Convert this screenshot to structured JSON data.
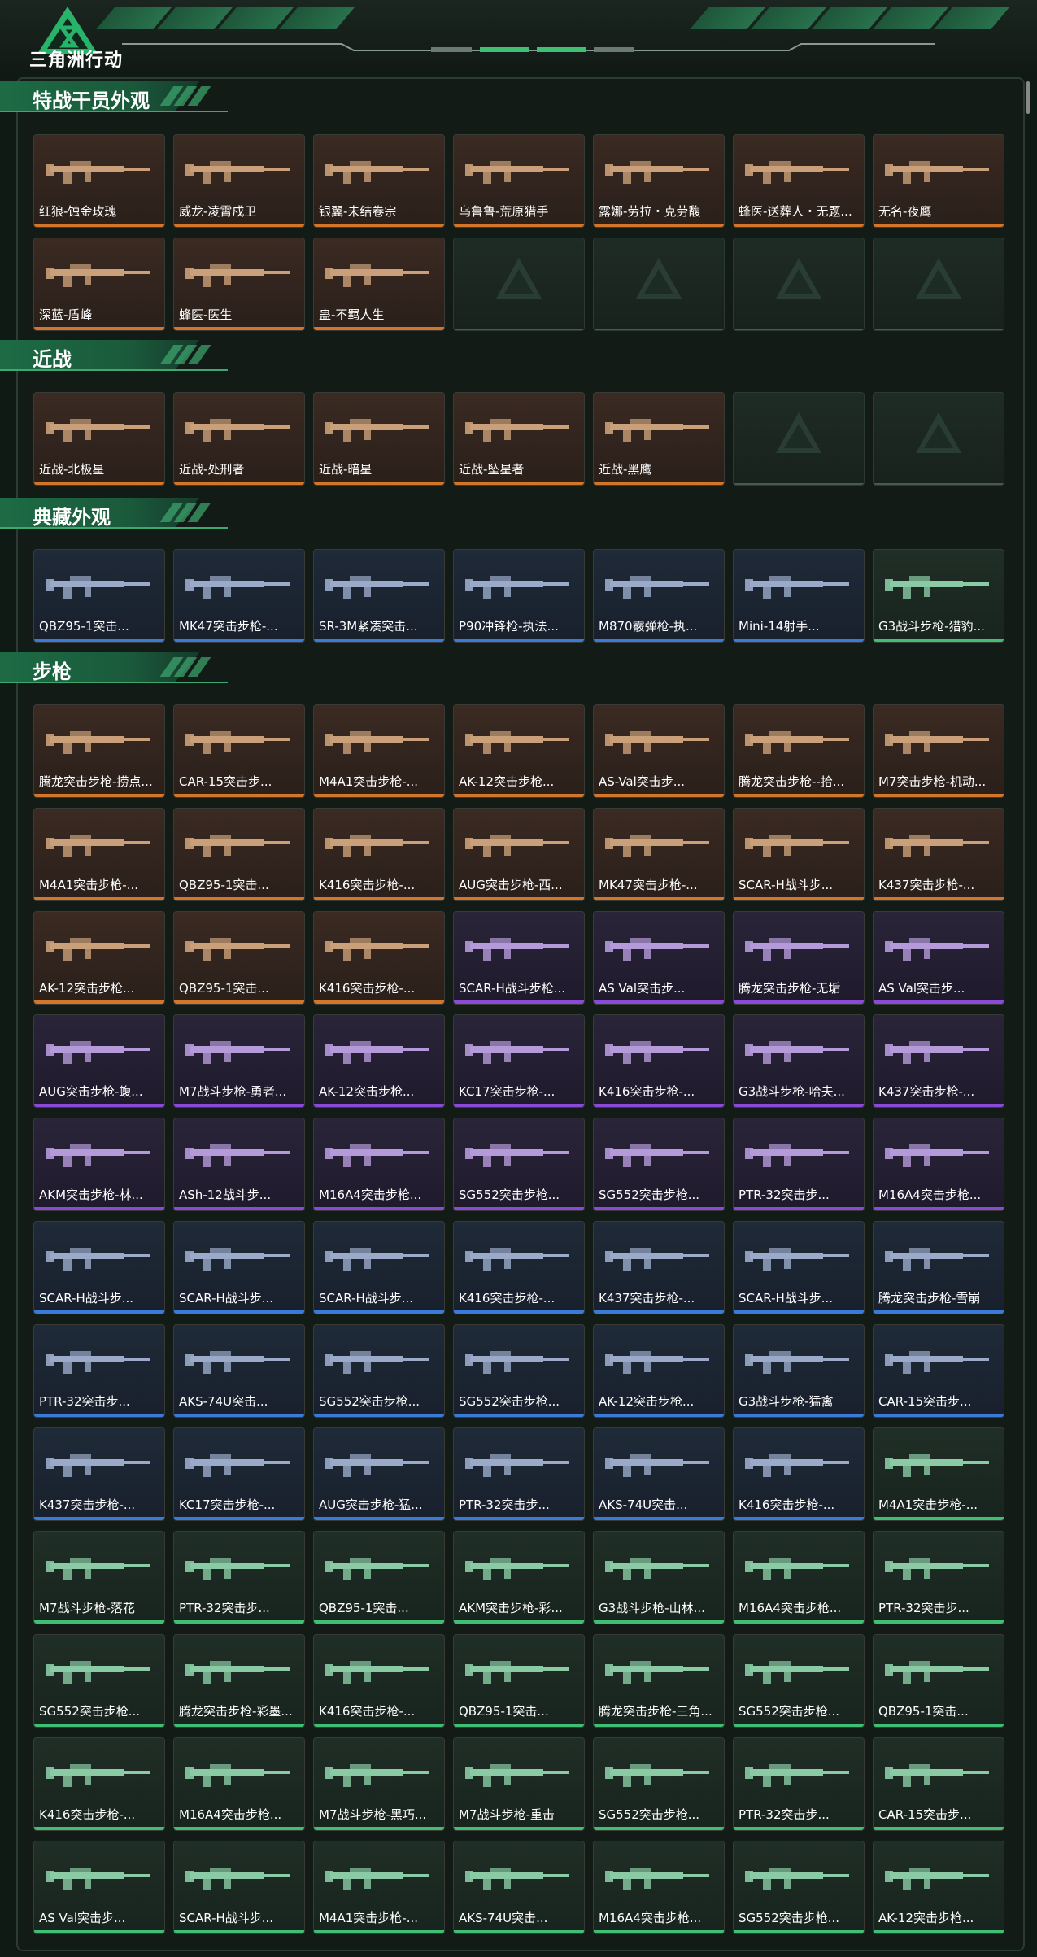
{
  "header": {
    "game_title": "三角洲行动",
    "logo_icon": "delta-logo-icon"
  },
  "colors": {
    "accent": "#2a7a52",
    "orange_rarity": "#d4762a",
    "purple_rarity": "#8a4ad8",
    "blue_rarity": "#3a7ad8",
    "green_rarity": "#3fbe74"
  },
  "sections": [
    {
      "id": "operators",
      "title": "特战干员外观",
      "items": [
        {
          "label": "红狼-蚀金玫瑰",
          "rarity": "orange"
        },
        {
          "label": "威龙-凌霄戍卫",
          "rarity": "orange"
        },
        {
          "label": "银翼-未结卷宗",
          "rarity": "orange"
        },
        {
          "label": "乌鲁鲁-荒原猎手",
          "rarity": "orange"
        },
        {
          "label": "露娜-劳拉・克劳馥",
          "rarity": "orange"
        },
        {
          "label": "蜂医-送葬人・无题...",
          "rarity": "orange"
        },
        {
          "label": "无名-夜鹰",
          "rarity": "orange"
        },
        {
          "label": "深蓝-盾峰",
          "rarity": "orange"
        },
        {
          "label": "蜂医-医生",
          "rarity": "orange"
        },
        {
          "label": "蛊-不羁人生",
          "rarity": "orange"
        }
      ],
      "empty_slots": 4
    },
    {
      "id": "melee",
      "title": "近战",
      "items": [
        {
          "label": "近战-北极星",
          "rarity": "orange"
        },
        {
          "label": "近战-处刑者",
          "rarity": "orange"
        },
        {
          "label": "近战-暗星",
          "rarity": "orange"
        },
        {
          "label": "近战-坠星者",
          "rarity": "orange"
        },
        {
          "label": "近战-黑鹰",
          "rarity": "orange"
        }
      ],
      "empty_slots": 2
    },
    {
      "id": "collection",
      "title": "典藏外观",
      "items": [
        {
          "label": "QBZ95-1突击...",
          "rarity": "blue"
        },
        {
          "label": "MK47突击步枪-...",
          "rarity": "blue"
        },
        {
          "label": "SR-3M紧凑突击...",
          "rarity": "blue"
        },
        {
          "label": "P90冲锋枪-执法...",
          "rarity": "blue"
        },
        {
          "label": "M870霰弹枪-执...",
          "rarity": "blue"
        },
        {
          "label": "Mini-14射手...",
          "rarity": "blue"
        },
        {
          "label": "G3战斗步枪-猎豹...",
          "rarity": "green"
        }
      ],
      "empty_slots": 0
    },
    {
      "id": "rifles",
      "title": "步枪",
      "items": [
        {
          "label": "腾龙突击步枪-捞点...",
          "rarity": "orange"
        },
        {
          "label": "CAR-15突击步...",
          "rarity": "orange"
        },
        {
          "label": "M4A1突击步枪-...",
          "rarity": "orange"
        },
        {
          "label": "AK-12突击步枪...",
          "rarity": "orange"
        },
        {
          "label": "AS-Val突击步...",
          "rarity": "orange"
        },
        {
          "label": "腾龙突击步枪--拾...",
          "rarity": "orange"
        },
        {
          "label": "M7突击步枪-机动...",
          "rarity": "orange"
        },
        {
          "label": "M4A1突击步枪-...",
          "rarity": "orange"
        },
        {
          "label": "QBZ95-1突击...",
          "rarity": "orange"
        },
        {
          "label": "K416突击步枪-...",
          "rarity": "orange"
        },
        {
          "label": "AUG突击步枪-西...",
          "rarity": "orange"
        },
        {
          "label": "MK47突击步枪-...",
          "rarity": "orange"
        },
        {
          "label": "SCAR-H战斗步...",
          "rarity": "orange"
        },
        {
          "label": "K437突击步枪-...",
          "rarity": "orange"
        },
        {
          "label": "AK-12突击步枪...",
          "rarity": "orange"
        },
        {
          "label": "QBZ95-1突击...",
          "rarity": "orange"
        },
        {
          "label": "K416突击步枪-...",
          "rarity": "orange"
        },
        {
          "label": "SCAR-H战斗步枪...",
          "rarity": "purple"
        },
        {
          "label": "AS Val突击步...",
          "rarity": "purple"
        },
        {
          "label": "腾龙突击步枪-无垢",
          "rarity": "purple"
        },
        {
          "label": "AS Val突击步...",
          "rarity": "purple"
        },
        {
          "label": "AUG突击步枪-蝮...",
          "rarity": "purple"
        },
        {
          "label": "M7战斗步枪-勇者...",
          "rarity": "purple"
        },
        {
          "label": "AK-12突击步枪...",
          "rarity": "purple"
        },
        {
          "label": "KC17突击步枪-...",
          "rarity": "purple"
        },
        {
          "label": "K416突击步枪-...",
          "rarity": "purple"
        },
        {
          "label": "G3战斗步枪-哈夫...",
          "rarity": "purple"
        },
        {
          "label": "K437突击步枪-...",
          "rarity": "purple"
        },
        {
          "label": "AKM突击步枪-林...",
          "rarity": "purple"
        },
        {
          "label": "ASh-12战斗步...",
          "rarity": "purple"
        },
        {
          "label": "M16A4突击步枪...",
          "rarity": "purple"
        },
        {
          "label": "SG552突击步枪...",
          "rarity": "purple"
        },
        {
          "label": "SG552突击步枪...",
          "rarity": "purple"
        },
        {
          "label": "PTR-32突击步...",
          "rarity": "purple"
        },
        {
          "label": "M16A4突击步枪...",
          "rarity": "purple"
        },
        {
          "label": "SCAR-H战斗步...",
          "rarity": "blue"
        },
        {
          "label": "SCAR-H战斗步...",
          "rarity": "blue"
        },
        {
          "label": "SCAR-H战斗步...",
          "rarity": "blue"
        },
        {
          "label": "K416突击步枪-...",
          "rarity": "blue"
        },
        {
          "label": "K437突击步枪-...",
          "rarity": "blue"
        },
        {
          "label": "SCAR-H战斗步...",
          "rarity": "blue"
        },
        {
          "label": "腾龙突击步枪-雪崩",
          "rarity": "blue"
        },
        {
          "label": "PTR-32突击步...",
          "rarity": "blue"
        },
        {
          "label": "AKS-74U突击...",
          "rarity": "blue"
        },
        {
          "label": "SG552突击步枪...",
          "rarity": "blue"
        },
        {
          "label": "SG552突击步枪...",
          "rarity": "blue"
        },
        {
          "label": "AK-12突击步枪...",
          "rarity": "blue"
        },
        {
          "label": "G3战斗步枪-猛禽",
          "rarity": "blue"
        },
        {
          "label": "CAR-15突击步...",
          "rarity": "blue"
        },
        {
          "label": "K437突击步枪-...",
          "rarity": "blue"
        },
        {
          "label": "KC17突击步枪-...",
          "rarity": "blue"
        },
        {
          "label": "AUG突击步枪-猛...",
          "rarity": "blue"
        },
        {
          "label": "PTR-32突击步...",
          "rarity": "blue"
        },
        {
          "label": "AKS-74U突击...",
          "rarity": "blue"
        },
        {
          "label": "K416突击步枪-...",
          "rarity": "blue"
        },
        {
          "label": "M4A1突击步枪-...",
          "rarity": "green"
        },
        {
          "label": "M7战斗步枪-落花",
          "rarity": "green"
        },
        {
          "label": "PTR-32突击步...",
          "rarity": "green"
        },
        {
          "label": "QBZ95-1突击...",
          "rarity": "green"
        },
        {
          "label": "AKM突击步枪-彩...",
          "rarity": "green"
        },
        {
          "label": "G3战斗步枪-山林...",
          "rarity": "green"
        },
        {
          "label": "M16A4突击步枪...",
          "rarity": "green"
        },
        {
          "label": "PTR-32突击步...",
          "rarity": "green"
        },
        {
          "label": "SG552突击步枪...",
          "rarity": "green"
        },
        {
          "label": "腾龙突击步枪-彩墨...",
          "rarity": "green"
        },
        {
          "label": "K416突击步枪-...",
          "rarity": "green"
        },
        {
          "label": "QBZ95-1突击...",
          "rarity": "green"
        },
        {
          "label": "腾龙突击步枪-三角...",
          "rarity": "green"
        },
        {
          "label": "SG552突击步枪...",
          "rarity": "green"
        },
        {
          "label": "QBZ95-1突击...",
          "rarity": "green"
        },
        {
          "label": "K416突击步枪-...",
          "rarity": "green"
        },
        {
          "label": "M16A4突击步枪...",
          "rarity": "green"
        },
        {
          "label": "M7战斗步枪-黑巧...",
          "rarity": "green"
        },
        {
          "label": "M7战斗步枪-重击",
          "rarity": "green"
        },
        {
          "label": "SG552突击步枪...",
          "rarity": "green"
        },
        {
          "label": "PTR-32突击步...",
          "rarity": "green"
        },
        {
          "label": "CAR-15突击步...",
          "rarity": "green"
        },
        {
          "label": "AS Val突击步...",
          "rarity": "green"
        },
        {
          "label": "SCAR-H战斗步...",
          "rarity": "green"
        },
        {
          "label": "M4A1突击步枪-...",
          "rarity": "green"
        },
        {
          "label": "AKS-74U突击...",
          "rarity": "green"
        },
        {
          "label": "M16A4突击步枪...",
          "rarity": "green"
        },
        {
          "label": "SG552突击步枪...",
          "rarity": "green"
        },
        {
          "label": "AK-12突击步枪...",
          "rarity": "green"
        }
      ],
      "empty_slots": 0
    }
  ]
}
